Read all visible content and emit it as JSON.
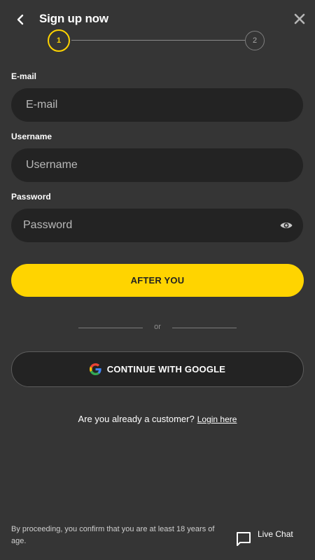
{
  "header": {
    "title": "Sign up now",
    "back_icon": "chevron-left-icon",
    "close_icon": "close-icon"
  },
  "stepper": {
    "current": 1,
    "steps": [
      "1",
      "2"
    ]
  },
  "form": {
    "email": {
      "label": "E-mail",
      "placeholder": "E-mail",
      "value": ""
    },
    "username": {
      "label": "Username",
      "placeholder": "Username",
      "value": ""
    },
    "password": {
      "label": "Password",
      "placeholder": "Password",
      "value": "",
      "toggle_icon": "eye-icon"
    }
  },
  "actions": {
    "primary_label": "AFTER YOU",
    "divider_text": "or",
    "google_label": "CONTINUE WITH GOOGLE"
  },
  "login": {
    "prompt": "Are you already a customer?",
    "link": "Login here"
  },
  "footer": {
    "disclaimer": "By proceeding, you confirm that you are at least 18 years of age.",
    "live_chat": "Live Chat"
  },
  "colors": {
    "background": "#353535",
    "field": "#232323",
    "accent": "#ffd400",
    "text": "#ffffff"
  }
}
